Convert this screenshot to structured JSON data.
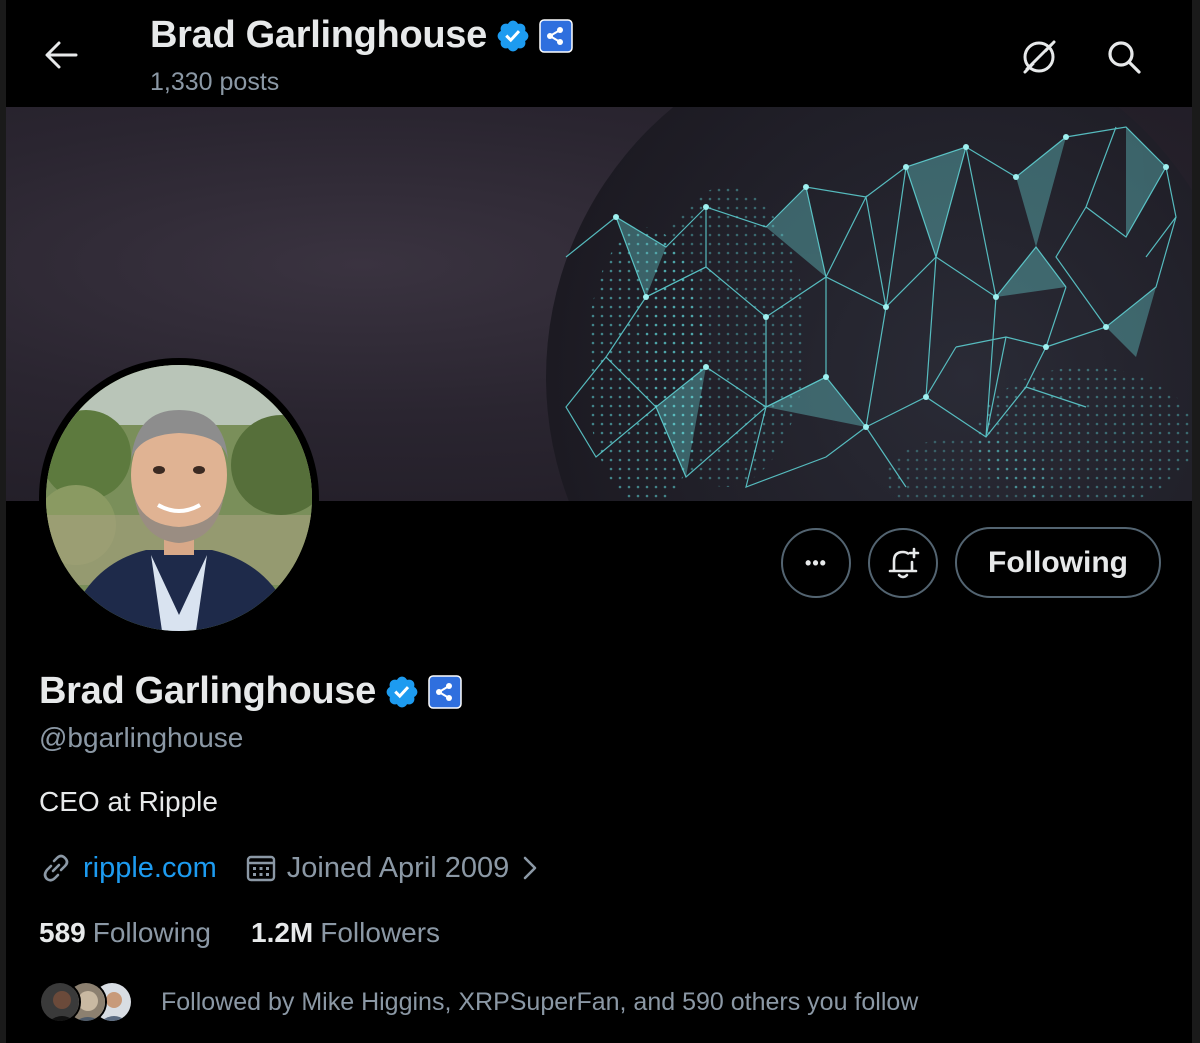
{
  "header": {
    "title": "Brad Garlinghouse",
    "posts_count": "1,330 posts",
    "back_icon": "arrow-left-icon",
    "grok_icon": "grok-icon",
    "search_icon": "search-icon"
  },
  "profile": {
    "name": "Brad Garlinghouse",
    "handle": "@bgarlinghouse",
    "bio": "CEO at Ripple",
    "website": "ripple.com",
    "joined": "Joined April 2009",
    "following_count": "589",
    "following_label": "Following",
    "followers_count": "1.2M",
    "followers_label": "Followers",
    "followed_by": "Followed by Mike Higgins, XRPSuperFan, and 590 others you follow"
  },
  "actions": {
    "more_label": "•••",
    "notify_icon": "bell-plus-icon",
    "following_button": "Following"
  },
  "colors": {
    "accent": "#1d9bf0",
    "verified": "#1d9bf0",
    "org_badge": "#1d6bd8",
    "muted_text": "#8b98a5",
    "banner_network": "#5fd6d8"
  }
}
